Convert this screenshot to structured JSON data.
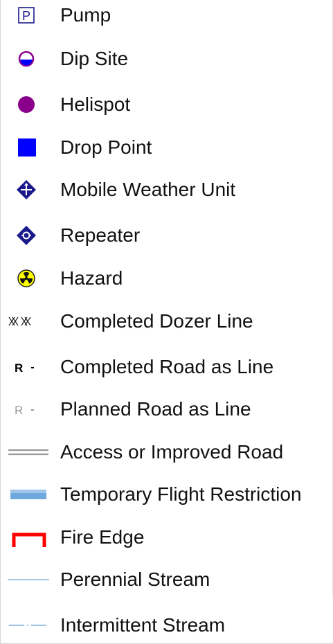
{
  "legend": {
    "items": [
      {
        "label": "Pump",
        "symbol": "pump-box-icon",
        "color": "#1a1a8c",
        "glyph": "P"
      },
      {
        "label": "Dip Site",
        "symbol": "dip-site-icon",
        "colors": [
          "#8b008b",
          "#0000ff",
          "#ffffff"
        ]
      },
      {
        "label": "Helispot",
        "symbol": "helispot-circle-icon",
        "color": "#8b008b"
      },
      {
        "label": "Drop Point",
        "symbol": "drop-point-square-icon",
        "color": "#0000ff"
      },
      {
        "label": "Mobile Weather Unit",
        "symbol": "mobile-weather-diamond-icon",
        "color": "#1a1a8c"
      },
      {
        "label": "Repeater",
        "symbol": "repeater-diamond-icon",
        "color": "#1a1a8c"
      },
      {
        "label": "Hazard",
        "symbol": "hazard-radiation-icon",
        "color": "#ffff00"
      },
      {
        "label": "Completed Dozer Line",
        "symbol": "dozer-line-icon",
        "color": "#222222"
      },
      {
        "label": "Completed Road as Line",
        "symbol": "completed-road-line-icon",
        "color": "#000000",
        "glyph": "R"
      },
      {
        "label": "Planned Road as Line",
        "symbol": "planned-road-line-icon",
        "color": "#9a9a9a",
        "glyph": "R"
      },
      {
        "label": "Access or Improved Road",
        "symbol": "access-road-line-icon",
        "color": "#9a9a9a"
      },
      {
        "label": "Temporary Flight Restriction",
        "symbol": "tfr-band-icon",
        "color": "#6fa8dc"
      },
      {
        "label": "Fire Edge",
        "symbol": "fire-edge-icon",
        "color": "#ff0000"
      },
      {
        "label": "Perennial Stream",
        "symbol": "perennial-stream-icon",
        "color": "#9fc5e8"
      },
      {
        "label": "Intermittent Stream",
        "symbol": "intermittent-stream-icon",
        "color": "#9fc5e8"
      }
    ]
  }
}
